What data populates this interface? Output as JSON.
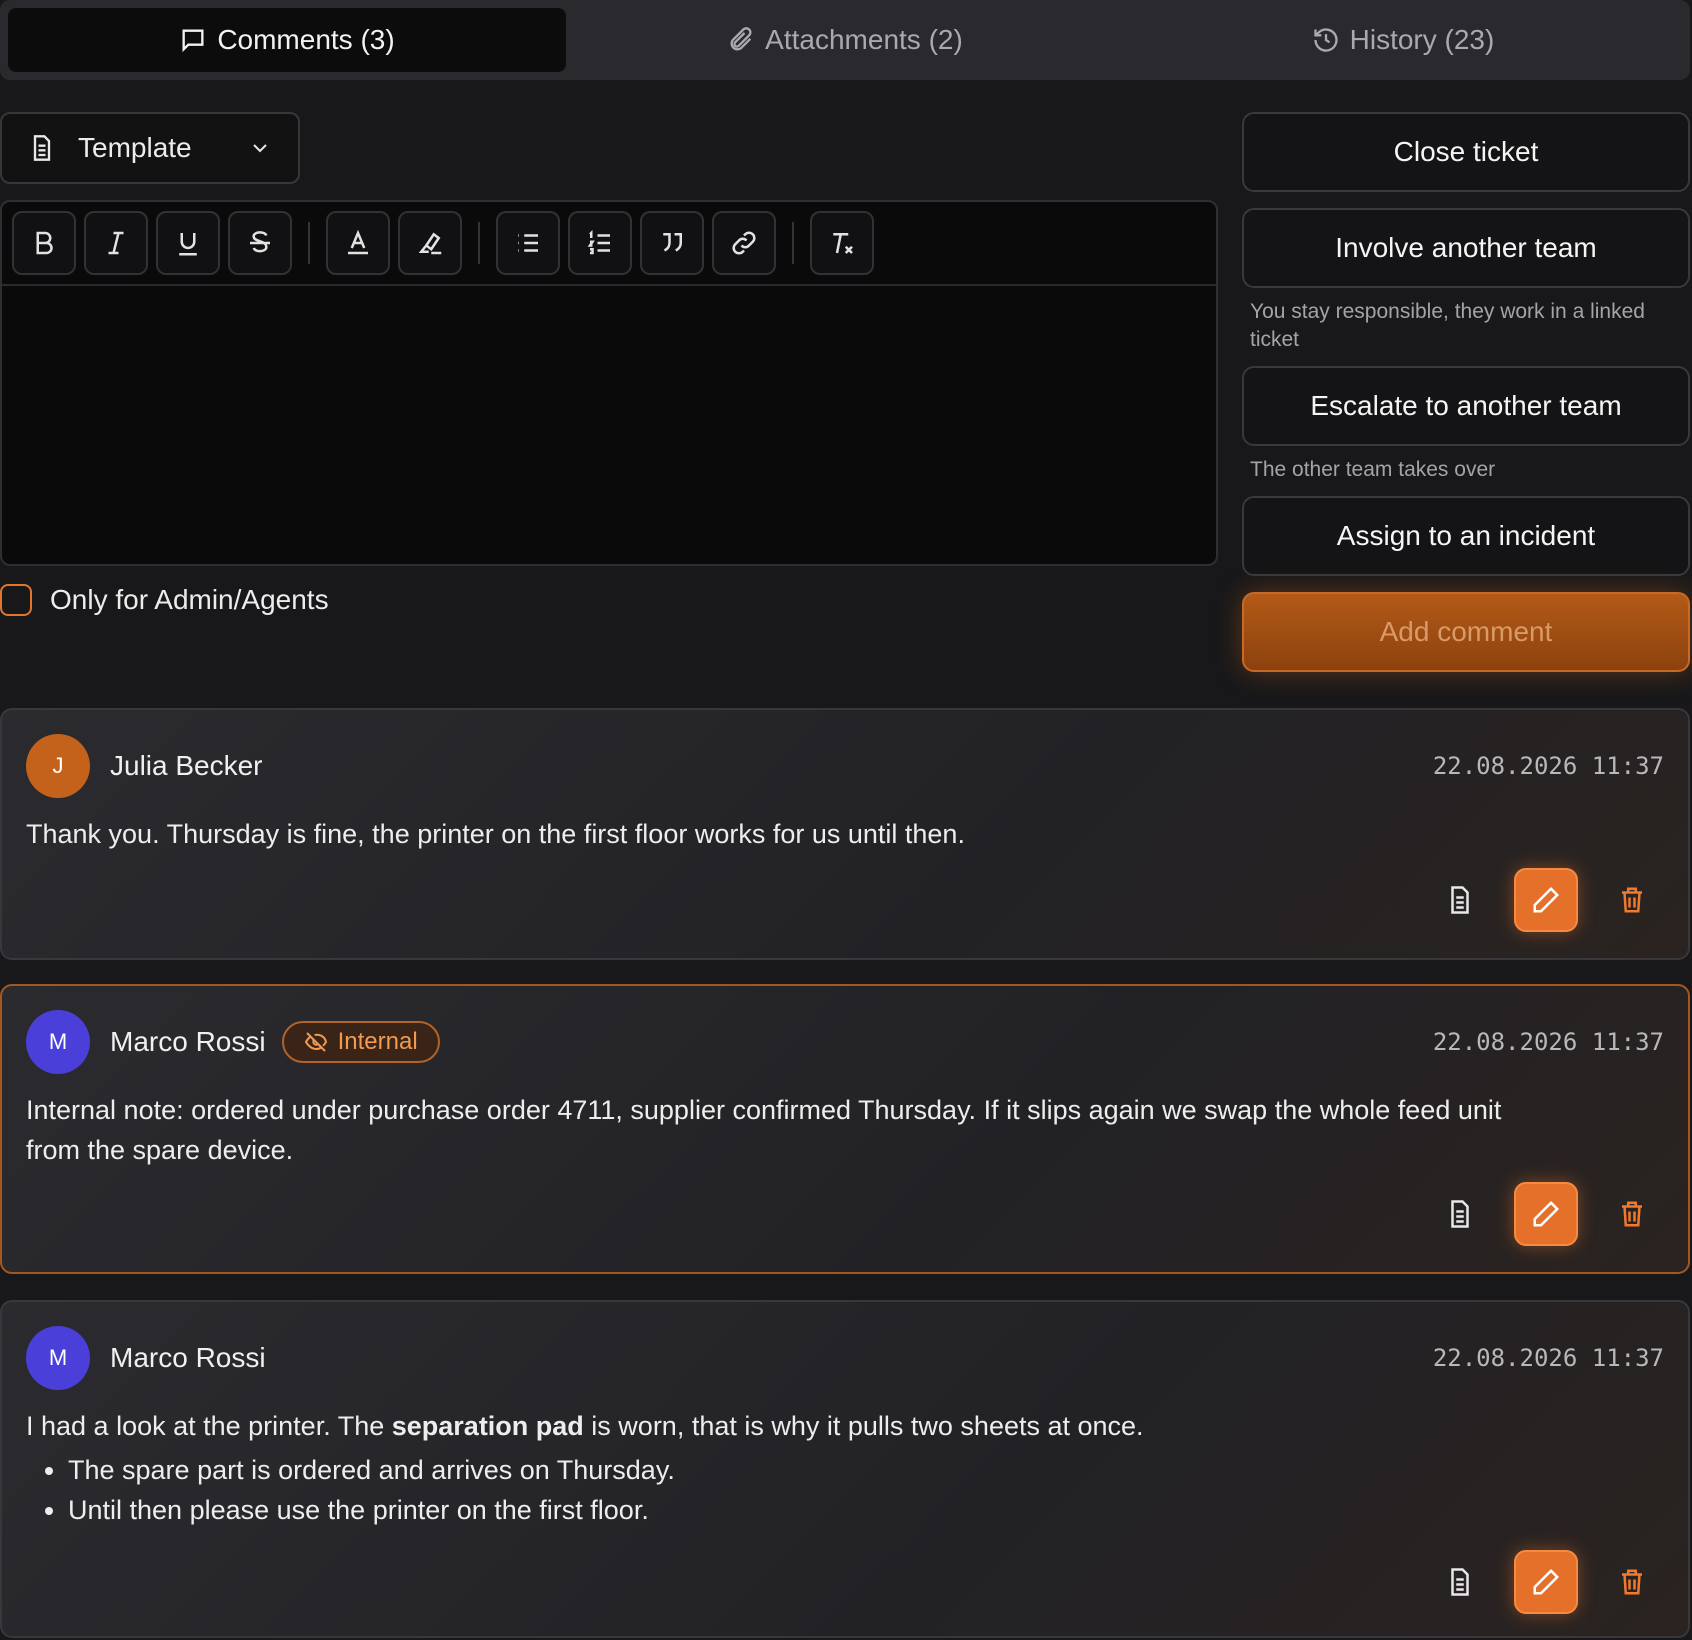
{
  "tabs": [
    {
      "label": "Comments (3)",
      "icon": "comment-icon"
    },
    {
      "label": "Attachments (2)",
      "icon": "paperclip-icon"
    },
    {
      "label": "History (23)",
      "icon": "history-icon"
    }
  ],
  "template": {
    "label": "Template"
  },
  "toolbar": [
    "bold",
    "italic",
    "underline",
    "strikethrough",
    "text-color",
    "highlight",
    "bullet-list",
    "numbered-list",
    "quote",
    "link",
    "clear-formatting"
  ],
  "admin_only": {
    "label": "Only for Admin/Agents",
    "checked": false
  },
  "actions": {
    "close": "Close ticket",
    "involve": "Involve another team",
    "involve_hint": "You stay responsible, they work in a linked ticket",
    "escalate": "Escalate to another team",
    "escalate_hint": "The other team takes over",
    "assign": "Assign to an incident",
    "add": "Add comment"
  },
  "colors": {
    "accent": "#e4702a",
    "avatar_j": "#c4621c",
    "avatar_m": "#4a3fd8"
  },
  "comments": [
    {
      "initial": "J",
      "author": "Julia Becker",
      "timestamp": "22.08.2026 11:37",
      "text": "Thank you. Thursday is fine, the printer on the first floor works for us until then."
    },
    {
      "initial": "M",
      "author": "Marco Rossi",
      "badge": "Internal",
      "timestamp": "22.08.2026 11:37",
      "line1": "Internal note: ordered under purchase order 4711, supplier confirmed Thursday. If it slips again we swap the whole feed unit",
      "line2": "from the spare device."
    },
    {
      "initial": "M",
      "author": "Marco Rossi",
      "timestamp": "22.08.2026 11:37",
      "pre": "I had a look at the printer. The ",
      "bold": "separation pad",
      "post": " is worn, that is why it pulls two sheets at once.",
      "bullets": [
        "The spare part is ordered and arrives on Thursday.",
        "Until then please use the printer on the first floor."
      ]
    }
  ]
}
